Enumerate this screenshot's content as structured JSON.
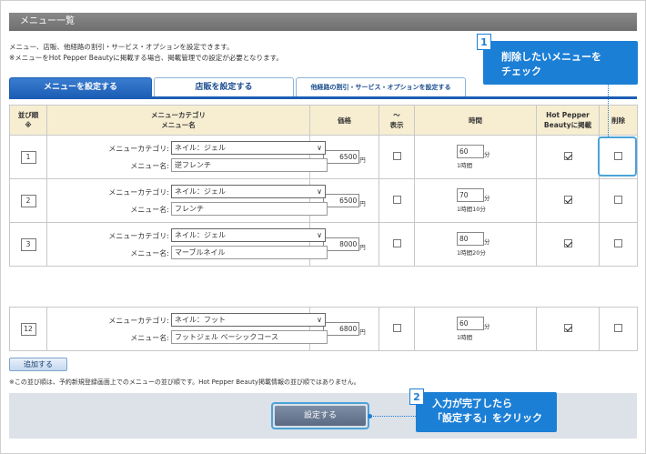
{
  "page": {
    "title": "メニュー一覧",
    "desc_line1": "メニュー、店販、他経路の割引・サービス・オプションを設定できます。",
    "desc_line2": "※メニューをHot Pepper Beautyに掲載する場合、掲載管理での設定が必要となります。"
  },
  "tabs": [
    {
      "label": "メニューを設定する",
      "active": true
    },
    {
      "label": "店販を設定する",
      "active": false
    },
    {
      "label": "他経路の割引・サービス・オプションを設定する",
      "active": false
    }
  ],
  "table": {
    "headers": {
      "order_line1": "並び順",
      "order_line2": "※",
      "category_line1": "メニューカテゴリ",
      "category_line2": "メニュー名",
      "price": "価格",
      "display_line1": "〜",
      "display_line2": "表示",
      "time": "時間",
      "hpb_line1": "Hot Pepper",
      "hpb_line2": "Beautyに掲載",
      "delete": "削除"
    },
    "category_label": "メニューカテゴリ:",
    "name_label": "メニュー名:",
    "price_unit": "円",
    "time_unit": "分",
    "rows": [
      {
        "order": "1",
        "category": "ネイル：ジェル",
        "name": "逆フレンチ",
        "price": "6500",
        "minutes": "60",
        "time_text": "1時間",
        "display": false,
        "hpb": true,
        "delete": false
      },
      {
        "order": "2",
        "category": "ネイル：ジェル",
        "name": "フレンチ",
        "price": "6500",
        "minutes": "70",
        "time_text": "1時間10分",
        "display": false,
        "hpb": true,
        "delete": false
      },
      {
        "order": "3",
        "category": "ネイル：ジェル",
        "name": "マーブルネイル",
        "price": "8000",
        "minutes": "80",
        "time_text": "1時間20分",
        "display": false,
        "hpb": true,
        "delete": false
      },
      {
        "order": "12",
        "category": "ネイル：フット",
        "name": "フットジェル ベーシックコース",
        "price": "6800",
        "minutes": "60",
        "time_text": "1時間",
        "display": false,
        "hpb": true,
        "delete": false
      }
    ]
  },
  "add_button": "追加する",
  "note": "※この並び順は、予約新規登録画面上でのメニューの並び順です。Hot Pepper Beauty掲載情報の並び順ではありません。",
  "submit_button": "設定する",
  "callouts": {
    "c1_num": "1",
    "c1_line1": "削除したいメニューを",
    "c1_line2": "チェック",
    "c2_num": "2",
    "c2_line1": "入力が完了したら",
    "c2_line2": "「設定する」をクリック"
  },
  "colors": {
    "accent": "#1c7fd6",
    "tab_active": "#1c5eb5",
    "header_bg": "#f7eed2"
  },
  "icons": {
    "select": "chevron-down-icon",
    "checkbox": "checkmark-icon"
  }
}
